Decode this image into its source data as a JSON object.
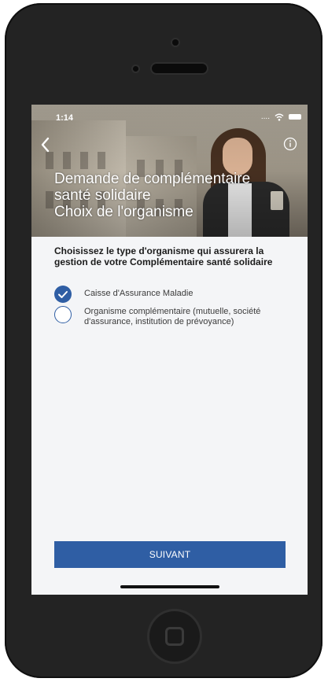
{
  "status_bar": {
    "time": "1:14",
    "signal": "....",
    "wifi_icon": "wifi-icon",
    "battery_icon": "battery-icon"
  },
  "header": {
    "back_icon": "chevron-left-icon",
    "info_icon": "info-icon",
    "title_lines": [
      "Demande de complémentaire",
      "santé solidaire",
      "Choix de l'organisme"
    ]
  },
  "question": "Choisissez le type d'organisme qui assurera la gestion de votre Complémentaire santé solidaire",
  "options": [
    {
      "label": "Caisse d'Assurance Maladie",
      "selected": true
    },
    {
      "label": "Organisme complémentaire (mutuelle, société d'assurance, institution de prévoyance)",
      "selected": false
    }
  ],
  "next_button": {
    "label": "SUIVANT"
  },
  "colors": {
    "accent": "#2f5ea4",
    "background": "#f4f5f7",
    "frame": "#232323"
  }
}
